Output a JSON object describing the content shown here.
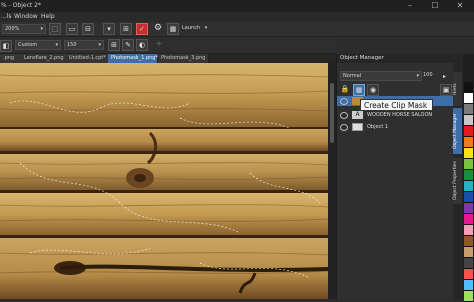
{
  "window": {
    "title": "% - Object 2*",
    "controls": [
      "–",
      "☐",
      "✕"
    ]
  },
  "menu": [
    "...ls",
    "Window",
    "Help"
  ],
  "toolbar": {
    "zoom": "200%",
    "launch_label": "Launch"
  },
  "propbar": {
    "preset": "Custom",
    "size": "150"
  },
  "doc_tabs": [
    {
      "label": ".png",
      "active": false
    },
    {
      "label": "Lensflare_2.png",
      "active": false
    },
    {
      "label": "Untitled-1.cpt*",
      "active": false
    },
    {
      "label": "Photomask_1.png*",
      "active": true
    },
    {
      "label": "Photomask_3.png",
      "active": false
    }
  ],
  "object_manager": {
    "title": "Object Manager",
    "blend_mode": "Normal",
    "opacity": "100",
    "objects": [
      {
        "label": "",
        "selected": true
      },
      {
        "label": "WOODEN HORSE SALOON",
        "selected": false
      },
      {
        "label": "Object 1",
        "selected": false
      }
    ],
    "tooltip": "Create Clip Mask"
  },
  "side_tabs": [
    "Hints",
    "Object Manager",
    "Object Properties"
  ],
  "palette": [
    "#111111",
    "#ffffff",
    "#7a7a7a",
    "#c8c8c8",
    "#e41b1b",
    "#f27a1a",
    "#f5e21a",
    "#7cc242",
    "#1a8f3c",
    "#22b5c8",
    "#1a4ea8",
    "#7a3aa8",
    "#e21a8a",
    "#f2a0b8",
    "#8a5a2a",
    "#c8a070",
    "#444444",
    "#ff5050",
    "#50c0ff",
    "#a0e060"
  ],
  "colors": {
    "accent": "#3d6ea8",
    "panel": "#2f2f2f",
    "wood_light": "#c9a35a",
    "wood_dark": "#5a3a18"
  }
}
